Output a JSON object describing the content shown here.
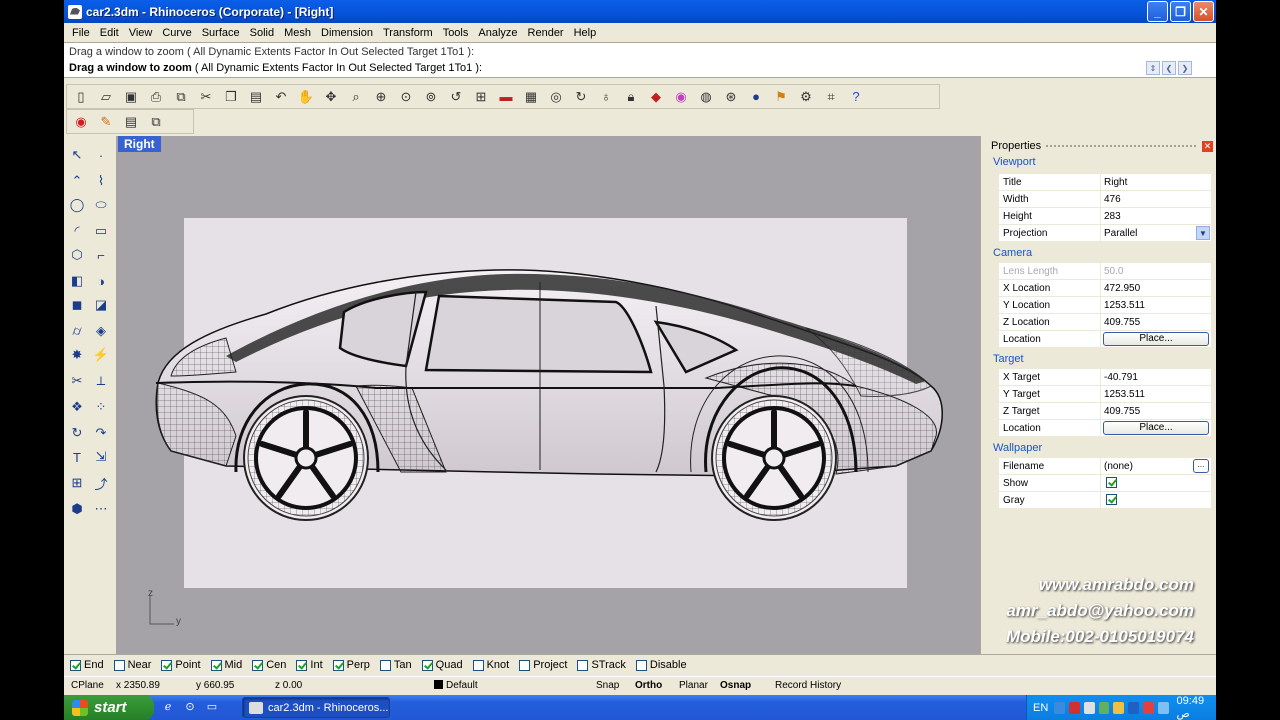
{
  "window": {
    "title": "car2.3dm - Rhinoceros (Corporate) - [Right]",
    "minimize": "_",
    "maximize": "❐",
    "close": "✕"
  },
  "menu": [
    "File",
    "Edit",
    "View",
    "Curve",
    "Surface",
    "Solid",
    "Mesh",
    "Dimension",
    "Transform",
    "Tools",
    "Analyze",
    "Render",
    "Help"
  ],
  "command": {
    "history": "Drag a window to zoom ( All  Dynamic  Extents  Factor  In  Out  Selected  Target  1To1 ):",
    "prompt": "Drag a window to zoom",
    "options": "( All  Dynamic  Extents  Factor  In  Out  Selected  Target  1To1 ):"
  },
  "toolbar_icons": [
    "new-icon",
    "open-icon",
    "save-icon",
    "print-icon",
    "import-icon",
    "cut-icon",
    "copy-icon",
    "paste-icon",
    "undo-icon",
    "pan-icon",
    "rotate-view-icon",
    "zoom-icon",
    "zoom-window-icon",
    "zoom-extents-icon",
    "zoom-selected-icon",
    "undo-view-icon",
    "four-viewports-icon",
    "car-icon",
    "cplane-icon",
    "named-view-icon",
    "rotate-icon",
    "light-icon",
    "lock-icon",
    "shade-icon",
    "render-icon",
    "sphere-icon",
    "mesh-sphere-icon",
    "render-sphere-icon",
    "flag-icon",
    "gear-icon",
    "grid-snap-icon",
    "help-icon"
  ],
  "toolbar2_icons": [
    "color-wheel-icon",
    "material-icon",
    "layers-icon",
    "properties-icon"
  ],
  "viewport": {
    "title": "Right",
    "axis_y": "y",
    "axis_z": "z"
  },
  "properties": {
    "title": "Properties",
    "close": "✕",
    "sections": {
      "viewport": "Viewport",
      "camera": "Camera",
      "target": "Target",
      "wallpaper": "Wallpaper"
    },
    "viewport_rows": [
      {
        "label": "Title",
        "value": "Right"
      },
      {
        "label": "Width",
        "value": "476"
      },
      {
        "label": "Height",
        "value": "283"
      },
      {
        "label": "Projection",
        "value": "Parallel"
      }
    ],
    "camera_rows": [
      {
        "label": "Lens Length",
        "value": "50.0"
      },
      {
        "label": "X Location",
        "value": "472.950"
      },
      {
        "label": "Y Location",
        "value": "1253.511"
      },
      {
        "label": "Z Location",
        "value": "409.755"
      },
      {
        "label": "Location",
        "value": "Place..."
      }
    ],
    "target_rows": [
      {
        "label": "X Target",
        "value": "-40.791"
      },
      {
        "label": "Y Target",
        "value": "1253.511"
      },
      {
        "label": "Z Target",
        "value": "409.755"
      },
      {
        "label": "Location",
        "value": "Place..."
      }
    ],
    "wallpaper_rows": [
      {
        "label": "Filename",
        "value": "(none)"
      },
      {
        "label": "Show",
        "value": true
      },
      {
        "label": "Gray",
        "value": true
      }
    ]
  },
  "watermark": {
    "line1": "www.amrabdo.com",
    "line2": "amr_abdo@yahoo.com",
    "line3": "Mobile:002-0105019074"
  },
  "osnap": [
    {
      "label": "End",
      "checked": true
    },
    {
      "label": "Near",
      "checked": false
    },
    {
      "label": "Point",
      "checked": true
    },
    {
      "label": "Mid",
      "checked": true
    },
    {
      "label": "Cen",
      "checked": true
    },
    {
      "label": "Int",
      "checked": true
    },
    {
      "label": "Perp",
      "checked": true
    },
    {
      "label": "Tan",
      "checked": false
    },
    {
      "label": "Quad",
      "checked": true
    },
    {
      "label": "Knot",
      "checked": false
    },
    {
      "label": "Project",
      "checked": false
    },
    {
      "label": "STrack",
      "checked": false
    },
    {
      "label": "Disable",
      "checked": false
    }
  ],
  "status": {
    "cplane": "CPlane",
    "x": "x 2350.89",
    "y": "y 660.95",
    "z": "z 0.00",
    "layer": "Default",
    "snap": "Snap",
    "ortho": "Ortho",
    "planar": "Planar",
    "osnap": "Osnap",
    "record_history": "Record History"
  },
  "taskbar": {
    "start": "start",
    "task_label": "car2.3dm - Rhinoceros...",
    "lang": "EN",
    "clock": "09:49 ص"
  }
}
